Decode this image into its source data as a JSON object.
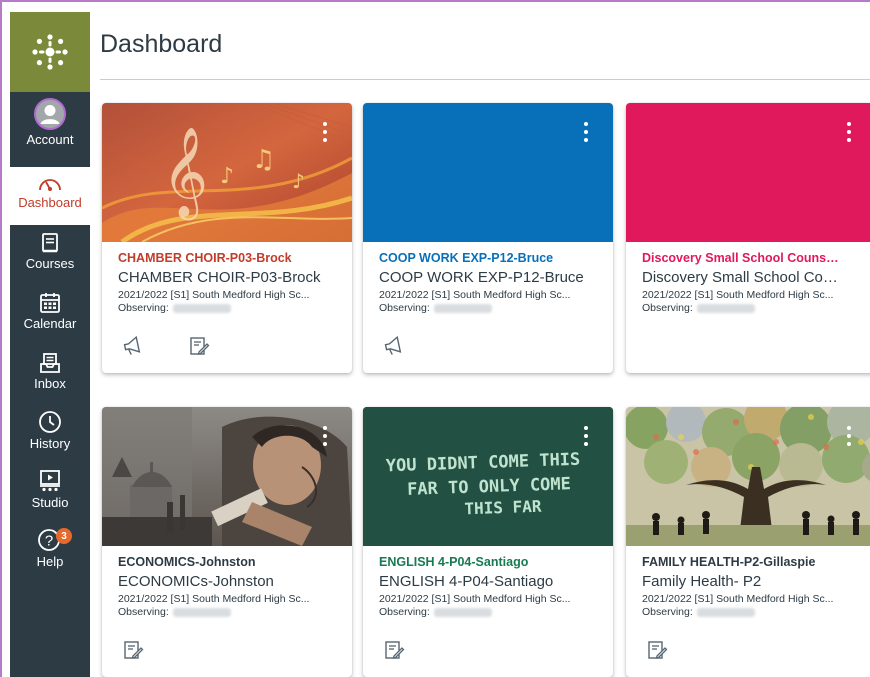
{
  "page": {
    "title": "Dashboard"
  },
  "nav": {
    "items": [
      {
        "label": "Account",
        "icon": "account-avatar-icon"
      },
      {
        "label": "Dashboard",
        "icon": "dashboard-gauge-icon",
        "active": true
      },
      {
        "label": "Courses",
        "icon": "courses-book-icon"
      },
      {
        "label": "Calendar",
        "icon": "calendar-icon"
      },
      {
        "label": "Inbox",
        "icon": "inbox-icon"
      },
      {
        "label": "History",
        "icon": "history-clock-icon"
      },
      {
        "label": "Studio",
        "icon": "studio-icon"
      },
      {
        "label": "Help",
        "icon": "help-question-icon",
        "badge": "3"
      }
    ]
  },
  "cards": [
    {
      "title": "CHAMBER CHOIR-P03-Brock",
      "name": "CHAMBER CHOIR-P03-Brock",
      "term": "2021/2022 [S1] South Medford High Sc...",
      "observing": "Observing:",
      "color": "#c23c2a",
      "hero": "music-notes-image",
      "actions": [
        "announcements-icon",
        "assignments-icon"
      ]
    },
    {
      "title": "COOP WORK EXP-P12-Bruce",
      "name": "COOP WORK EXP-P12-Bruce",
      "term": "2021/2022 [S1] South Medford High Sc...",
      "observing": "Observing:",
      "color": "#0770b8",
      "hero": "solid-blue",
      "actions": [
        "announcements-icon"
      ]
    },
    {
      "title": "Discovery Small School Counselor",
      "name": "Discovery Small School Couns...",
      "term": "2021/2022 [S1] South Medford High Sc...",
      "observing": "Observing:",
      "color": "#e0195c",
      "hero": "solid-pink",
      "actions": []
    },
    {
      "title": "ECONOMICS-Johnston",
      "name": "ECONOMICs-Johnston",
      "term": "2021/2022 [S1] South Medford High Sc...",
      "observing": "Observing:",
      "color": "#2d3b45",
      "hero": "economics-illustration-image",
      "actions": [
        "assignments-icon"
      ]
    },
    {
      "title": "ENGLISH 4-P04-Santiago",
      "name": "ENGLISH 4-P04-Santiago",
      "term": "2021/2022 [S1] South Medford High Sc...",
      "observing": "Observing:",
      "color": "#177a53",
      "hero": "chalkboard-image",
      "hero_text": [
        "YOU DIDNT COME THIS",
        "FAR TO ONLY COME",
        "THIS FAR"
      ],
      "actions": [
        "assignments-icon"
      ]
    },
    {
      "title": "FAMILY HEALTH-P2-Gillaspie",
      "name": "Family Health- P2",
      "term": "2021/2022 [S1] South Medford High Sc...",
      "observing": "Observing:",
      "color": "#2d3b45",
      "hero": "family-tree-image",
      "actions": [
        "assignments-icon"
      ]
    }
  ]
}
